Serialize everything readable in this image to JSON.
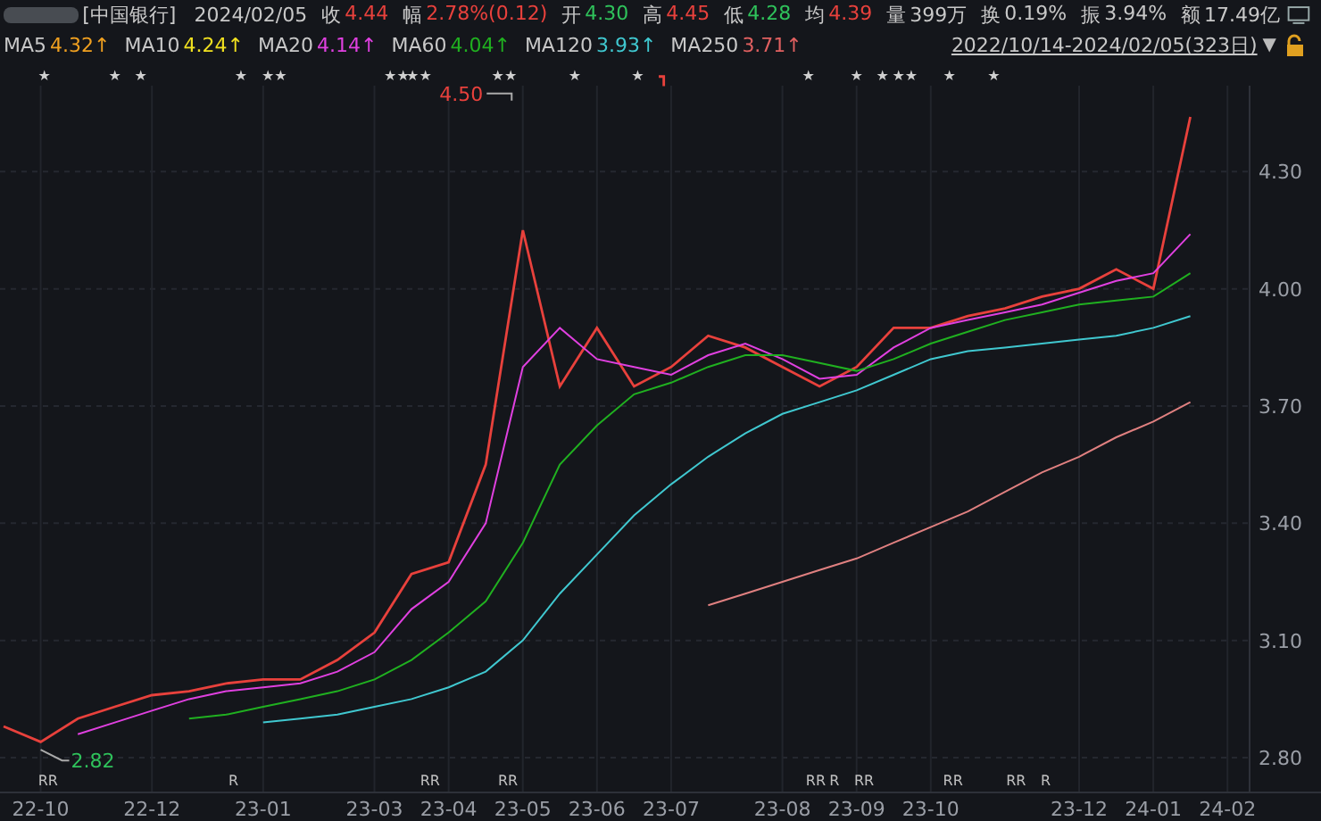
{
  "header": {
    "name": "[中国银行]",
    "date": "2024/02/05",
    "quote": [
      {
        "label": "收",
        "value": "4.44",
        "color": "#e8413c"
      },
      {
        "label": "幅",
        "value": "2.78%(0.12)",
        "color": "#e8413c"
      },
      {
        "label": "开",
        "value": "4.30",
        "color": "#2fc25b"
      },
      {
        "label": "高",
        "value": "4.45",
        "color": "#e8413c"
      },
      {
        "label": "低",
        "value": "4.28",
        "color": "#2fc25b"
      },
      {
        "label": "均",
        "value": "4.39",
        "color": "#e8413c"
      },
      {
        "label": "量",
        "value": "399万",
        "color": "#c8c8c8"
      },
      {
        "label": "换",
        "value": "0.19%",
        "color": "#c8c8c8"
      },
      {
        "label": "振",
        "value": "3.94%",
        "color": "#c8c8c8"
      },
      {
        "label": "额",
        "value": "17.49亿",
        "color": "#c8c8c8"
      }
    ]
  },
  "moving_averages": [
    {
      "label": "MA5",
      "value": "4.32↑",
      "color": "#f0a020"
    },
    {
      "label": "MA10",
      "value": "4.24↑",
      "color": "#f0e020"
    },
    {
      "label": "MA20",
      "value": "4.14↑",
      "color": "#e040e0"
    },
    {
      "label": "MA60",
      "value": "4.04↑",
      "color": "#20b020"
    },
    {
      "label": "MA120",
      "value": "3.93↑",
      "color": "#40c8d0"
    },
    {
      "label": "MA250",
      "value": "3.71↑",
      "color": "#e06060"
    }
  ],
  "range": {
    "text": "2022/10/14-2024/02/05(323日)",
    "caret": "▼"
  },
  "chart": {
    "chart_data": {
      "type": "line",
      "categories": [
        null,
        "22-10",
        null,
        null,
        "22-12",
        null,
        null,
        "23-01",
        null,
        null,
        "23-03",
        null,
        "23-04",
        null,
        "23-05",
        null,
        "23-06",
        null,
        "23-07",
        null,
        null,
        "23-08",
        null,
        "23-09",
        null,
        "23-10",
        null,
        null,
        null,
        "23-12",
        null,
        "24-01",
        null,
        "24-02"
      ],
      "series": [
        {
          "color": "#e8413c",
          "values": [
            2.88,
            2.84,
            2.9,
            2.93,
            2.96,
            2.97,
            2.99,
            3.0,
            3.0,
            3.05,
            3.12,
            3.27,
            3.3,
            3.55,
            4.15,
            3.75,
            3.9,
            3.75,
            3.8,
            3.88,
            3.85,
            3.8,
            3.75,
            3.8,
            3.9,
            3.9,
            3.93,
            3.95,
            3.98,
            4.0,
            4.05,
            4.0,
            4.44,
            null
          ]
        },
        {
          "color": "#e040e0",
          "values": [
            null,
            null,
            2.86,
            2.89,
            2.92,
            2.95,
            2.97,
            2.98,
            2.99,
            3.02,
            3.07,
            3.18,
            3.25,
            3.4,
            3.8,
            3.9,
            3.82,
            3.8,
            3.78,
            3.83,
            3.86,
            3.82,
            3.77,
            3.78,
            3.85,
            3.9,
            3.92,
            3.94,
            3.96,
            3.99,
            4.02,
            4.04,
            4.14,
            null
          ]
        },
        {
          "color": "#20b020",
          "values": [
            null,
            null,
            null,
            null,
            null,
            2.9,
            2.91,
            2.93,
            2.95,
            2.97,
            3.0,
            3.05,
            3.12,
            3.2,
            3.35,
            3.55,
            3.65,
            3.73,
            3.76,
            3.8,
            3.83,
            3.83,
            3.81,
            3.79,
            3.82,
            3.86,
            3.89,
            3.92,
            3.94,
            3.96,
            3.97,
            3.98,
            4.04,
            null
          ]
        },
        {
          "color": "#40c8d0",
          "values": [
            null,
            null,
            null,
            null,
            null,
            null,
            null,
            2.89,
            2.9,
            2.91,
            2.93,
            2.95,
            2.98,
            3.02,
            3.1,
            3.22,
            3.32,
            3.42,
            3.5,
            3.57,
            3.63,
            3.68,
            3.71,
            3.74,
            3.78,
            3.82,
            3.84,
            3.85,
            3.86,
            3.87,
            3.88,
            3.9,
            3.93,
            null
          ]
        },
        {
          "color": "#e08080",
          "values": [
            null,
            null,
            null,
            null,
            null,
            null,
            null,
            null,
            null,
            null,
            null,
            null,
            null,
            null,
            null,
            null,
            null,
            null,
            null,
            3.19,
            3.22,
            3.25,
            3.28,
            3.31,
            3.35,
            3.39,
            3.43,
            3.48,
            3.53,
            3.57,
            3.62,
            3.66,
            3.71,
            null
          ]
        }
      ],
      "ylim": [
        2.72,
        4.52
      ],
      "grid": true,
      "yticks": [
        {
          "value": 2.8,
          "label": "2.80"
        },
        {
          "value": 3.1,
          "label": "3.10"
        },
        {
          "value": 3.4,
          "label": "3.40"
        },
        {
          "value": 3.7,
          "label": "3.70"
        },
        {
          "value": 4.0,
          "label": "4.00"
        },
        {
          "value": 4.3,
          "label": "4.30"
        }
      ],
      "annotations": [
        "4.50",
        "2.82"
      ]
    },
    "star_markers": [
      "★",
      "★",
      "★",
      "★",
      "★★",
      "★★",
      "★★",
      "★★",
      "★",
      "★",
      "┓",
      "★",
      "★",
      "★",
      "★★",
      "★",
      "★"
    ],
    "event_markers": [
      "RR",
      "R",
      "RR",
      "RR",
      "RR",
      "R",
      "RR",
      "RR",
      "RR",
      "R"
    ]
  }
}
